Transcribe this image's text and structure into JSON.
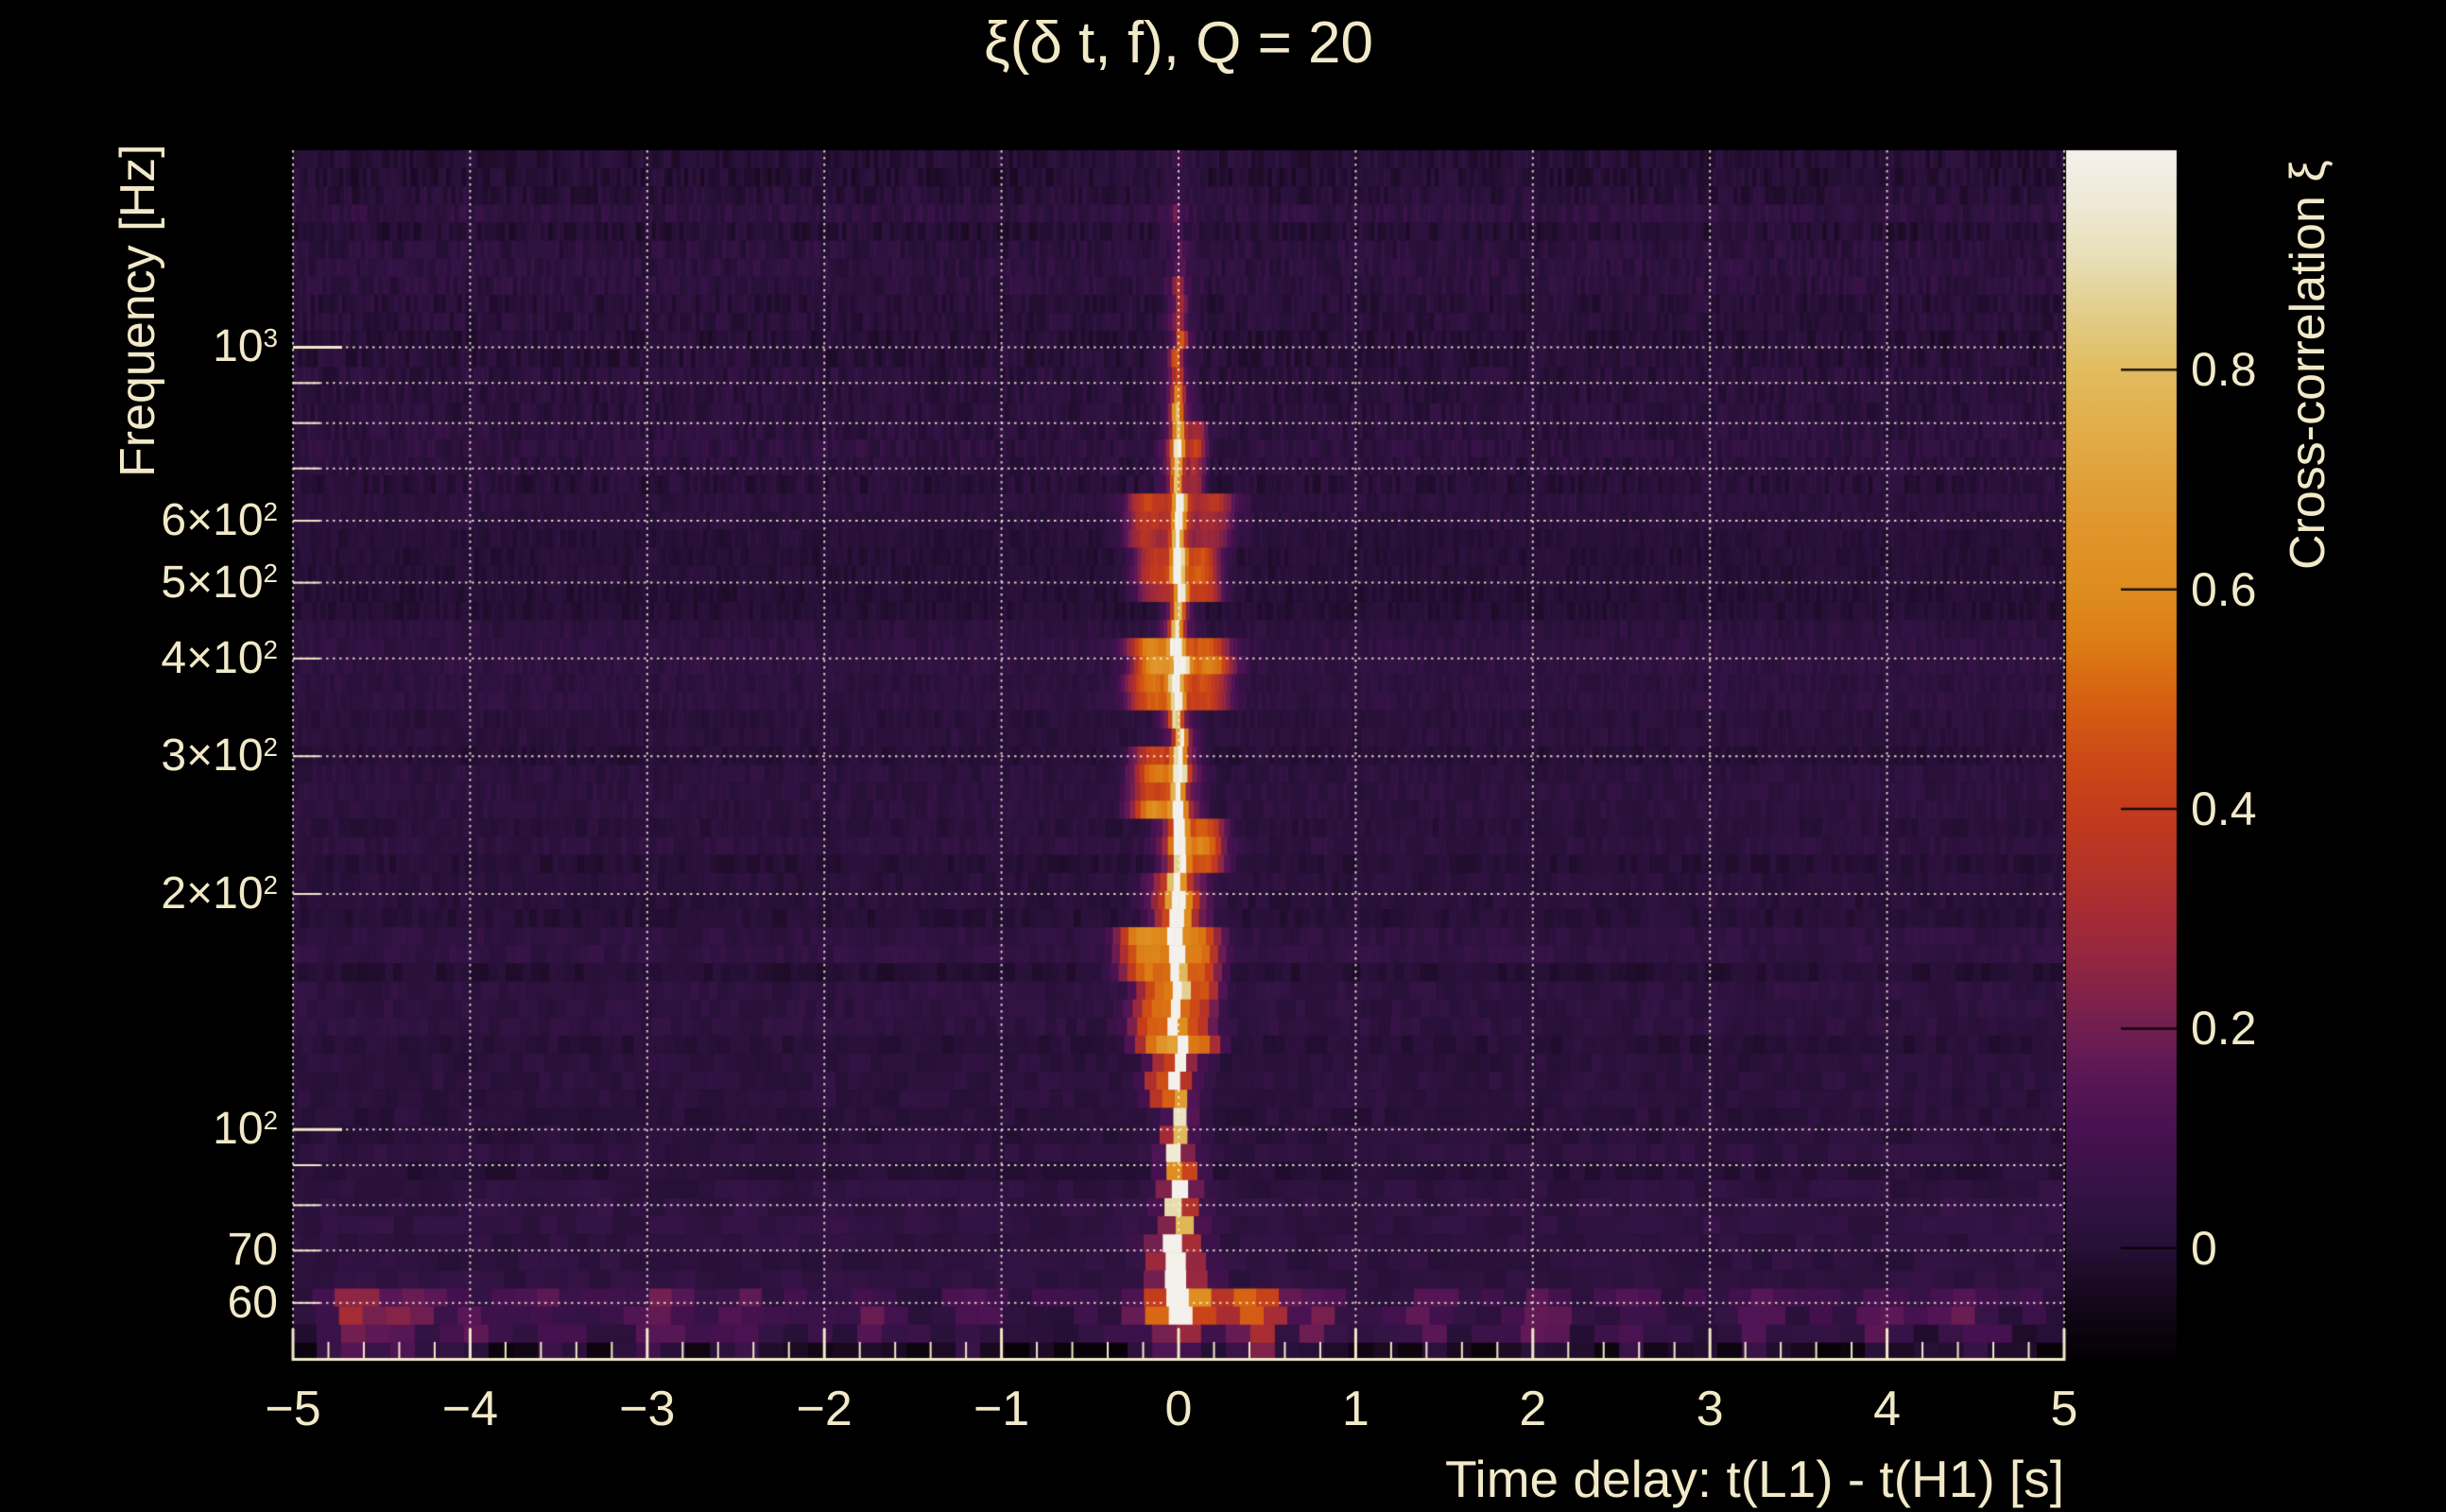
{
  "colors": {
    "background": "#000000",
    "text": "#f2e9c8",
    "axis": "#f2e9c8",
    "gridline": "rgba(247,240,219,0.85)",
    "colorbar_tick": "rgba(5,3,2,0.9)"
  },
  "chart_data": {
    "type": "heatmap",
    "title": "ξ(δ t, f), Q = 20",
    "xlabel": "Time delay: t(L1) - t(H1) [s]",
    "ylabel": "Frequency [Hz]",
    "colorbar_label": "Cross-correlation ξ",
    "xlim": [
      -5,
      5
    ],
    "x_minor_step": 0.2,
    "ylim_hz": [
      50.6,
      1786
    ],
    "y_scale": "log",
    "zlim": [
      -0.1,
      1.0
    ],
    "grid": "dotted, at integer time delays and at 60-100,200-1000 Hz",
    "legend_position": "right colorbar",
    "x_ticks": [
      {
        "t": -5,
        "label": "−5"
      },
      {
        "t": -4,
        "label": "−4"
      },
      {
        "t": -3,
        "label": "−3"
      },
      {
        "t": -2,
        "label": "−2"
      },
      {
        "t": -1,
        "label": "−1"
      },
      {
        "t": 0,
        "label": "0"
      },
      {
        "t": 1,
        "label": "1"
      },
      {
        "t": 2,
        "label": "2"
      },
      {
        "t": 3,
        "label": "3"
      },
      {
        "t": 4,
        "label": "4"
      },
      {
        "t": 5,
        "label": "5"
      }
    ],
    "y_ticks": [
      {
        "f": 1000,
        "base": "10",
        "exp": "3",
        "major": true
      },
      {
        "f": 600,
        "base": "6×10",
        "exp": "2",
        "major": false
      },
      {
        "f": 500,
        "base": "5×10",
        "exp": "2",
        "major": false
      },
      {
        "f": 400,
        "base": "4×10",
        "exp": "2",
        "major": false
      },
      {
        "f": 300,
        "base": "3×10",
        "exp": "2",
        "major": false
      },
      {
        "f": 200,
        "base": "2×10",
        "exp": "2",
        "major": false
      },
      {
        "f": 100,
        "base": "10",
        "exp": "2",
        "major": true
      },
      {
        "f": 70,
        "base": "70",
        "exp": "",
        "major": false
      },
      {
        "f": 60,
        "base": "60",
        "exp": "",
        "major": false
      }
    ],
    "y_gridlines_hz": [
      60,
      70,
      80,
      90,
      100,
      200,
      300,
      400,
      500,
      600,
      700,
      800,
      900,
      1000
    ],
    "y_minor_tick_hz": [
      900,
      800,
      700,
      600,
      500,
      400,
      300,
      200,
      90,
      80,
      70,
      60
    ],
    "colorbar_ticks": [
      {
        "v": 0.8,
        "label": "0.8"
      },
      {
        "v": 0.6,
        "label": "0.6"
      },
      {
        "v": 0.4,
        "label": "0.4"
      },
      {
        "v": 0.2,
        "label": "0.2"
      },
      {
        "v": 0.0,
        "label": "0"
      }
    ],
    "colormap_stops": [
      [
        -0.1,
        "#050106"
      ],
      [
        -0.05,
        "#140719"
      ],
      [
        0.0,
        "#261036"
      ],
      [
        0.05,
        "#341345"
      ],
      [
        0.1,
        "#45114f"
      ],
      [
        0.15,
        "#571656"
      ],
      [
        0.2,
        "#711f50"
      ],
      [
        0.25,
        "#8c2544"
      ],
      [
        0.3,
        "#a42b36"
      ],
      [
        0.35,
        "#b63427"
      ],
      [
        0.4,
        "#c43c1c"
      ],
      [
        0.45,
        "#ce4b16"
      ],
      [
        0.5,
        "#d66112"
      ],
      [
        0.55,
        "#dc7c15"
      ],
      [
        0.6,
        "#df8d1f"
      ],
      [
        0.65,
        "#e0942a"
      ],
      [
        0.7,
        "#e0a23a"
      ],
      [
        0.75,
        "#e2af4c"
      ],
      [
        0.8,
        "#e1bc60"
      ],
      [
        0.85,
        "#e3cd89"
      ],
      [
        0.9,
        "#e7dfb5"
      ],
      [
        0.95,
        "#efe9d6"
      ],
      [
        1.0,
        "#f4f1ec"
      ]
    ],
    "background_level": 0.018,
    "noise_sigma": 0.024,
    "noise_sigma_highfreq": 0.035,
    "ridge": {
      "t_center_s": 0.0,
      "comment": "correlation ridge at zero lag; amplitudes are peak ξ per frequency band, widths/offsets in seconds",
      "bands": [
        {
          "f": [
            50,
            55
          ],
          "core": 0.3,
          "cw": 0.045,
          "halo": 0.12,
          "hw": 0.13,
          "lobes": []
        },
        {
          "f": [
            55,
            64
          ],
          "core": 1.05,
          "cw": 0.055,
          "halo": 0.55,
          "hw": 0.14,
          "lobes": [
            {
              "o": 0.37,
              "a": 0.22,
              "w": 0.15
            }
          ]
        },
        {
          "f": [
            64,
            72
          ],
          "core": 0.95,
          "cw": 0.035,
          "halo": 0.4,
          "hw": 0.1,
          "lobes": []
        },
        {
          "f": [
            72,
            90
          ],
          "core": 0.88,
          "cw": 0.026,
          "halo": 0.33,
          "hw": 0.075,
          "lobes": []
        },
        {
          "f": [
            90,
            106
          ],
          "core": 0.75,
          "cw": 0.023,
          "halo": 0.27,
          "hw": 0.065,
          "lobes": []
        },
        {
          "f": [
            106,
            126
          ],
          "core": 0.85,
          "cw": 0.024,
          "halo": 0.33,
          "hw": 0.075,
          "lobes": [
            {
              "o": -0.11,
              "a": 0.28,
              "w": 0.05
            }
          ]
        },
        {
          "f": [
            126,
            152
          ],
          "core": 0.9,
          "cw": 0.024,
          "halo": 0.38,
          "hw": 0.085,
          "lobes": [
            {
              "o": -0.15,
              "a": 0.42,
              "w": 0.08
            },
            {
              "o": 0.14,
              "a": 0.33,
              "w": 0.06
            }
          ]
        },
        {
          "f": [
            152,
            186
          ],
          "core": 0.95,
          "cw": 0.024,
          "halo": 0.42,
          "hw": 0.09,
          "lobes": [
            {
              "o": -0.2,
              "a": 0.5,
              "w": 0.09
            },
            {
              "o": 0.16,
              "a": 0.38,
              "w": 0.07
            }
          ]
        },
        {
          "f": [
            186,
            218
          ],
          "core": 1.0,
          "cw": 0.027,
          "halo": 0.5,
          "hw": 0.1,
          "lobes": []
        },
        {
          "f": [
            218,
            252
          ],
          "core": 0.88,
          "cw": 0.024,
          "halo": 0.38,
          "hw": 0.08,
          "lobes": [
            {
              "o": 0.16,
              "a": 0.42,
              "w": 0.07
            }
          ]
        },
        {
          "f": [
            252,
            305
          ],
          "core": 0.84,
          "cw": 0.024,
          "halo": 0.33,
          "hw": 0.075,
          "lobes": [
            {
              "o": -0.16,
              "a": 0.45,
              "w": 0.08
            }
          ]
        },
        {
          "f": [
            305,
            348
          ],
          "core": 0.68,
          "cw": 0.022,
          "halo": 0.27,
          "hw": 0.06,
          "lobes": []
        },
        {
          "f": [
            348,
            432
          ],
          "core": 0.9,
          "cw": 0.024,
          "halo": 0.4,
          "hw": 0.09,
          "lobes": [
            {
              "o": -0.17,
              "a": 0.45,
              "w": 0.08
            },
            {
              "o": 0.19,
              "a": 0.4,
              "w": 0.08
            }
          ]
        },
        {
          "f": [
            432,
            472
          ],
          "core": 0.7,
          "cw": 0.022,
          "halo": 0.28,
          "hw": 0.06,
          "lobes": []
        },
        {
          "f": [
            472,
            565
          ],
          "core": 0.84,
          "cw": 0.024,
          "halo": 0.36,
          "hw": 0.08,
          "lobes": [
            {
              "o": 0.15,
              "a": 0.4,
              "w": 0.07
            },
            {
              "o": -0.16,
              "a": 0.32,
              "w": 0.07
            }
          ]
        },
        {
          "f": [
            565,
            665
          ],
          "core": 0.78,
          "cw": 0.022,
          "halo": 0.32,
          "hw": 0.075,
          "lobes": [
            {
              "o": -0.19,
              "a": 0.36,
              "w": 0.08
            },
            {
              "o": 0.2,
              "a": 0.3,
              "w": 0.08
            }
          ]
        },
        {
          "f": [
            665,
            785
          ],
          "core": 0.7,
          "cw": 0.021,
          "halo": 0.27,
          "hw": 0.06,
          "lobes": [
            {
              "o": 0.11,
              "a": 0.3,
              "w": 0.035
            }
          ]
        },
        {
          "f": [
            785,
            905
          ],
          "core": 0.52,
          "cw": 0.021,
          "halo": 0.2,
          "hw": 0.055,
          "lobes": []
        },
        {
          "f": [
            905,
            1060
          ],
          "core": 0.36,
          "cw": 0.021,
          "halo": 0.15,
          "hw": 0.055,
          "lobes": []
        },
        {
          "f": [
            1060,
            1260
          ],
          "core": 0.2,
          "cw": 0.022,
          "halo": 0.09,
          "hw": 0.06,
          "lobes": []
        },
        {
          "f": [
            1260,
            1510
          ],
          "core": 0.1,
          "cw": 0.025,
          "halo": 0.05,
          "hw": 0.07,
          "lobes": []
        },
        {
          "f": [
            1510,
            1800
          ],
          "core": 0.04,
          "cw": 0.03,
          "halo": 0.02,
          "hw": 0.08,
          "lobes": []
        }
      ]
    },
    "low_freq_noise_patches": [
      {
        "t": -4.65,
        "a": 0.18,
        "w": 0.12
      },
      {
        "t": -4.35,
        "a": 0.14,
        "w": 0.1
      },
      {
        "t": -4.05,
        "a": 0.12,
        "w": 0.08
      },
      {
        "t": -3.55,
        "a": 0.1,
        "w": 0.1
      },
      {
        "t": -2.95,
        "a": 0.14,
        "w": 0.12
      },
      {
        "t": -2.45,
        "a": 0.1,
        "w": 0.08
      },
      {
        "t": -1.75,
        "a": 0.09,
        "w": 0.1
      },
      {
        "t": -1.15,
        "a": 0.08,
        "w": 0.08
      },
      {
        "t": 0.45,
        "a": 0.3,
        "w": 0.1
      },
      {
        "t": 0.78,
        "a": 0.12,
        "w": 0.08
      },
      {
        "t": 1.45,
        "a": 0.1,
        "w": 0.1
      },
      {
        "t": 2.05,
        "a": 0.12,
        "w": 0.09
      },
      {
        "t": 2.55,
        "a": 0.09,
        "w": 0.08
      },
      {
        "t": 3.25,
        "a": 0.1,
        "w": 0.1
      },
      {
        "t": 3.95,
        "a": 0.11,
        "w": 0.09
      },
      {
        "t": 4.45,
        "a": 0.13,
        "w": 0.1
      }
    ]
  }
}
